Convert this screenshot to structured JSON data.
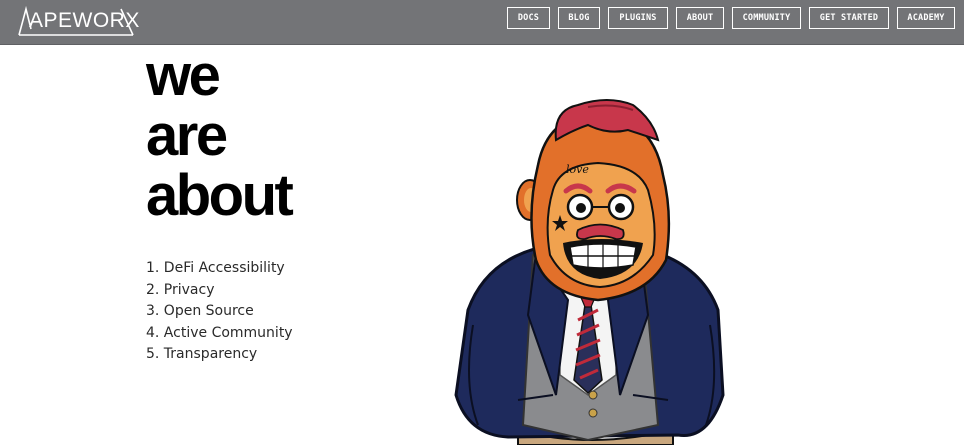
{
  "header": {
    "logo_text": "APEWORX",
    "nav": [
      "DOCS",
      "BLOG",
      "PLUGINS",
      "ABOUT",
      "COMMUNITY",
      "GET STARTED",
      "ACADEMY"
    ]
  },
  "hero": {
    "headline": [
      "we",
      "are",
      "about"
    ],
    "values": [
      "1. DeFi Accessibility",
      "2. Privacy",
      "3. Open Source",
      "4. Active Community",
      "5. Transparency"
    ],
    "mascot_tattoo": "love"
  },
  "colors": {
    "navbar": "#737477",
    "nav_text": "#ffffff",
    "ape_fur": "#e2702a",
    "ape_face": "#f0a24f",
    "hair": "#c8374b",
    "suit": "#1e2a5c",
    "vest": "#8a8b8e",
    "tie_stripe": "#c02a3a"
  },
  "icons": [
    "apeworx-logo-icon",
    "ape-mascot-illustration"
  ]
}
